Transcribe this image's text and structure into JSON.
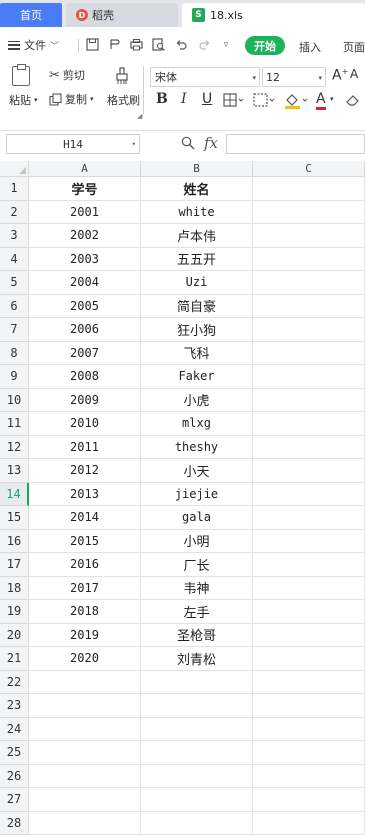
{
  "tabs": {
    "home": "首页",
    "docer": "稻壳",
    "file": "18.xls"
  },
  "menu": {
    "file": "文件",
    "start": "开始",
    "insert": "插入",
    "page": "页面"
  },
  "ribbon": {
    "paste": "粘贴",
    "cut": "剪切",
    "copy": "复制",
    "format_painter": "格式刷",
    "font_name": "宋体",
    "font_size": "12",
    "bold": "B",
    "italic": "I",
    "underline": "U",
    "font_grow": "A⁺",
    "font_color": "A"
  },
  "formula_bar": {
    "cell_ref": "H14",
    "fx": "fx",
    "formula": ""
  },
  "sheet": {
    "columns": [
      "A",
      "B",
      "C"
    ],
    "active_row": 14,
    "headers": {
      "id": "学号",
      "name": "姓名"
    },
    "rows": [
      {
        "n": "1",
        "a": "学号",
        "b": "姓名"
      },
      {
        "n": "2",
        "a": "2001",
        "b": "white"
      },
      {
        "n": "3",
        "a": "2002",
        "b": "卢本伟"
      },
      {
        "n": "4",
        "a": "2003",
        "b": "五五开"
      },
      {
        "n": "5",
        "a": "2004",
        "b": "Uzi"
      },
      {
        "n": "6",
        "a": "2005",
        "b": "简自豪"
      },
      {
        "n": "7",
        "a": "2006",
        "b": "狂小狗"
      },
      {
        "n": "8",
        "a": "2007",
        "b": "飞科"
      },
      {
        "n": "9",
        "a": "2008",
        "b": "Faker"
      },
      {
        "n": "10",
        "a": "2009",
        "b": "小虎"
      },
      {
        "n": "11",
        "a": "2010",
        "b": "mlxg"
      },
      {
        "n": "12",
        "a": "2011",
        "b": "theshy"
      },
      {
        "n": "13",
        "a": "2012",
        "b": "小天"
      },
      {
        "n": "14",
        "a": "2013",
        "b": "jiejie"
      },
      {
        "n": "15",
        "a": "2014",
        "b": "gala"
      },
      {
        "n": "16",
        "a": "2015",
        "b": "小明"
      },
      {
        "n": "17",
        "a": "2016",
        "b": "厂长"
      },
      {
        "n": "18",
        "a": "2017",
        "b": "韦神"
      },
      {
        "n": "19",
        "a": "2018",
        "b": "左手"
      },
      {
        "n": "20",
        "a": "2019",
        "b": "圣枪哥"
      },
      {
        "n": "21",
        "a": "2020",
        "b": "刘青松"
      },
      {
        "n": "22",
        "a": "",
        "b": ""
      },
      {
        "n": "23",
        "a": "",
        "b": ""
      },
      {
        "n": "24",
        "a": "",
        "b": ""
      },
      {
        "n": "25",
        "a": "",
        "b": ""
      },
      {
        "n": "26",
        "a": "",
        "b": ""
      },
      {
        "n": "27",
        "a": "",
        "b": ""
      },
      {
        "n": "28",
        "a": "",
        "b": ""
      }
    ]
  },
  "colors": {
    "home_tab": "#4a7cf7",
    "start_button": "#1bb25a",
    "active_row": "#17a866",
    "xls_icon": "#27a65d",
    "docer_icon": "#e8553f"
  }
}
